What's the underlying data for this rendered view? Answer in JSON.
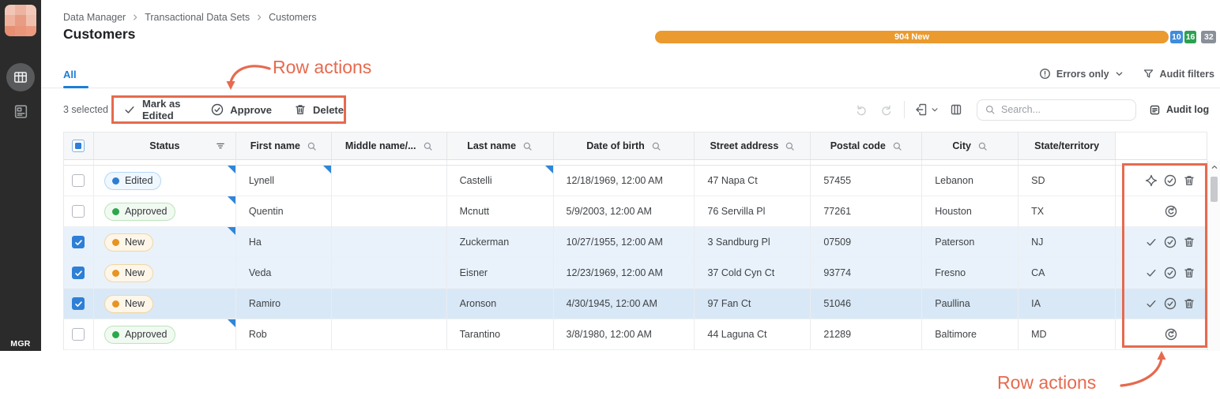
{
  "colors": {
    "accent_blue": "#1c7ed6",
    "checkbox_blue": "#2e7fd6",
    "annotation_orange": "#e66a4e",
    "progress_orange": "#ea9a2f",
    "badge_blue": "#3f8cdc",
    "badge_green": "#2ba14f",
    "badge_gray": "#8a9099",
    "status_edited_dot": "#2e7dd1",
    "status_approved_dot": "#2aa84a",
    "status_new_dot": "#e79422",
    "edited_corner": "#2f86d8",
    "logo_palette": [
      "#f2c6b6",
      "#edb4a2",
      "#f3c8b8",
      "#eeb29d",
      "#e99c84",
      "#f1bfae",
      "#e78f72",
      "#e8957a",
      "#ec9b80"
    ]
  },
  "sidebar": {
    "logo_text": "MGR",
    "nav": [
      {
        "icon": "data-set-grid-icon",
        "active": true
      },
      {
        "icon": "form-doc-icon",
        "active": false
      }
    ]
  },
  "header": {
    "breadcrumb": [
      "Data Manager",
      "Transactional Data Sets",
      "Customers"
    ],
    "title": "Customers"
  },
  "progress": {
    "bar_label": "904 New",
    "segments": [
      {
        "label": "10",
        "kind": "blue"
      },
      {
        "label": "16",
        "kind": "green"
      },
      {
        "label": "32",
        "kind": "gray"
      }
    ]
  },
  "tabs": {
    "items": [
      {
        "label": "All",
        "active": true
      }
    ]
  },
  "filters": {
    "errors_only": "Errors only",
    "audit_filters": "Audit filters"
  },
  "selection": {
    "count_label": "3 selected",
    "actions": [
      {
        "name": "mark-as-edited",
        "label": "Mark as Edited",
        "icon": "check-icon"
      },
      {
        "name": "approve",
        "label": "Approve",
        "icon": "circle-check-icon"
      },
      {
        "name": "delete",
        "label": "Delete",
        "icon": "trash-icon"
      }
    ]
  },
  "toolbar": {
    "search_placeholder": "Search...",
    "audit_log_label": "Audit log"
  },
  "annotations": {
    "top_label": "Row actions",
    "bottom_label": "Row actions"
  },
  "table": {
    "columns": [
      {
        "key": "status",
        "label": "Status",
        "header_icon": "filter-icon"
      },
      {
        "key": "first",
        "label": "First name",
        "header_icon": "search-icon"
      },
      {
        "key": "middle",
        "label": "Middle name/...",
        "header_icon": "search-icon"
      },
      {
        "key": "last",
        "label": "Last name",
        "header_icon": "search-icon"
      },
      {
        "key": "dob",
        "label": "Date of birth",
        "header_icon": "search-icon"
      },
      {
        "key": "street",
        "label": "Street address",
        "header_icon": "search-icon"
      },
      {
        "key": "postal",
        "label": "Postal code",
        "header_icon": "search-icon"
      },
      {
        "key": "city",
        "label": "City",
        "header_icon": "search-icon"
      },
      {
        "key": "state",
        "label": "State/territory",
        "header_icon": null
      }
    ],
    "header_checkbox": "indeterminate",
    "rows": [
      {
        "checked": false,
        "selected": false,
        "hovered": false,
        "status": "Edited",
        "cells": {
          "first": "Lynell",
          "middle": "",
          "last": "Castelli",
          "dob": "12/18/1969, 12:00 AM",
          "street": "47 Napa Ct",
          "postal": "57455",
          "city": "Lebanon",
          "state": "SD"
        },
        "edited_cells": [
          "status",
          "first",
          "last"
        ],
        "actions": [
          "sparkle",
          "approve",
          "delete"
        ]
      },
      {
        "checked": false,
        "selected": false,
        "hovered": false,
        "status": "Approved",
        "cells": {
          "first": "Quentin",
          "middle": "",
          "last": "Mcnutt",
          "dob": "5/9/2003, 12:00 AM",
          "street": "76 Servilla Pl",
          "postal": "77261",
          "city": "Houston",
          "state": "TX"
        },
        "edited_cells": [
          "status"
        ],
        "actions": [
          "revert"
        ]
      },
      {
        "checked": true,
        "selected": true,
        "hovered": false,
        "status": "New",
        "cells": {
          "first": "Ha",
          "middle": "",
          "last": "Zuckerman",
          "dob": "10/27/1955, 12:00 AM",
          "street": "3 Sandburg Pl",
          "postal": "07509",
          "city": "Paterson",
          "state": "NJ"
        },
        "edited_cells": [
          "status"
        ],
        "actions": [
          "mark-edited",
          "approve",
          "delete"
        ]
      },
      {
        "checked": true,
        "selected": true,
        "hovered": false,
        "status": "New",
        "cells": {
          "first": "Veda",
          "middle": "",
          "last": "Eisner",
          "dob": "12/23/1969, 12:00 AM",
          "street": "37 Cold Cyn Ct",
          "postal": "93774",
          "city": "Fresno",
          "state": "CA"
        },
        "edited_cells": [],
        "actions": [
          "mark-edited",
          "approve",
          "delete"
        ]
      },
      {
        "checked": true,
        "selected": true,
        "hovered": true,
        "status": "New",
        "cells": {
          "first": "Ramiro",
          "middle": "",
          "last": "Aronson",
          "dob": "4/30/1945, 12:00 AM",
          "street": "97 Fan Ct",
          "postal": "51046",
          "city": "Paullina",
          "state": "IA"
        },
        "edited_cells": [],
        "actions": [
          "mark-edited",
          "approve",
          "delete"
        ]
      },
      {
        "checked": false,
        "selected": false,
        "hovered": false,
        "status": "Approved",
        "cells": {
          "first": "Rob",
          "middle": "",
          "last": "Tarantino",
          "dob": "3/8/1980, 12:00 AM",
          "street": "44 Laguna Ct",
          "postal": "21289",
          "city": "Baltimore",
          "state": "MD"
        },
        "edited_cells": [
          "status"
        ],
        "actions": [
          "revert"
        ]
      }
    ]
  }
}
